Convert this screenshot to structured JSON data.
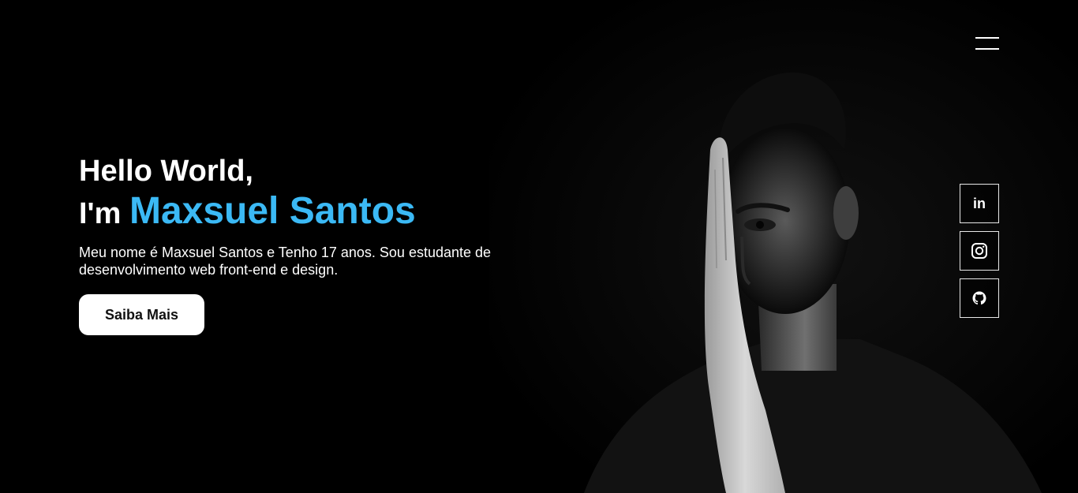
{
  "menu": {
    "icon": "hamburger-icon"
  },
  "intro": {
    "greeting": "Hello World,",
    "name_prefix": "I'm",
    "name": "Maxsuel Santos",
    "description": "Meu nome é Maxsuel Santos e Tenho 17 anos. Sou estudante de desenvolvimento web front-end e design.",
    "button_label": "Saiba Mais"
  },
  "social": {
    "items": [
      {
        "icon": "linkedin-icon",
        "label": "in"
      },
      {
        "icon": "instagram-icon"
      },
      {
        "icon": "github-icon"
      }
    ]
  },
  "colors": {
    "background": "#000000",
    "accent": "#3bb9f5",
    "text": "#ffffff",
    "button_background": "#ffffff",
    "button_text": "#111111"
  }
}
